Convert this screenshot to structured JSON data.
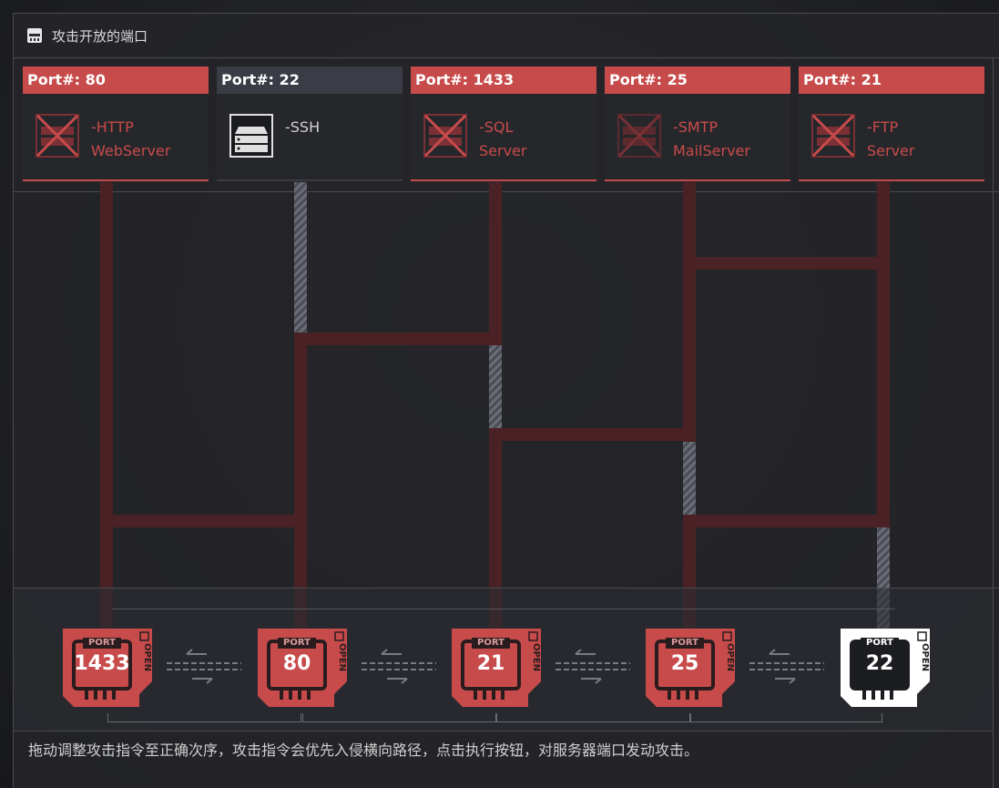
{
  "panel": {
    "title": "攻击开放的端口",
    "title_icon": "server-rack-icon"
  },
  "servers": [
    {
      "port_label": "Port#: 80",
      "name": "-HTTP\nWebServer",
      "status": "vulnerable"
    },
    {
      "port_label": "Port#: 22",
      "name": "-SSH",
      "status": "secure"
    },
    {
      "port_label": "Port#: 1433",
      "name": "-SQL\nServer",
      "status": "vulnerable"
    },
    {
      "port_label": "Port#: 25",
      "name": "-SMTP\nMailServer",
      "status": "vulnerable"
    },
    {
      "port_label": "Port#: 21",
      "name": "-FTP\nServer",
      "status": "vulnerable"
    }
  ],
  "attack_slots": [
    {
      "tag": "PORT",
      "number": "1433",
      "badge": "OPEN",
      "style": "red"
    },
    {
      "tag": "PORT",
      "number": "80",
      "badge": "OPEN",
      "style": "red"
    },
    {
      "tag": "PORT",
      "number": "21",
      "badge": "OPEN",
      "style": "red"
    },
    {
      "tag": "PORT",
      "number": "25",
      "badge": "OPEN",
      "style": "red"
    },
    {
      "tag": "PORT",
      "number": "22",
      "badge": "OPEN",
      "style": "white"
    }
  ],
  "hint": "拖动调整攻击指令至正确次序，攻击指令会优先入侵横向路径，点击执行按钮，对服务器端口发动攻击。",
  "colors": {
    "accent_red": "#c84b4b",
    "path_red": "#4a2226",
    "path_gray": "#5d6068",
    "panel_bg": "#242529",
    "secure_head": "#3a3d46"
  }
}
